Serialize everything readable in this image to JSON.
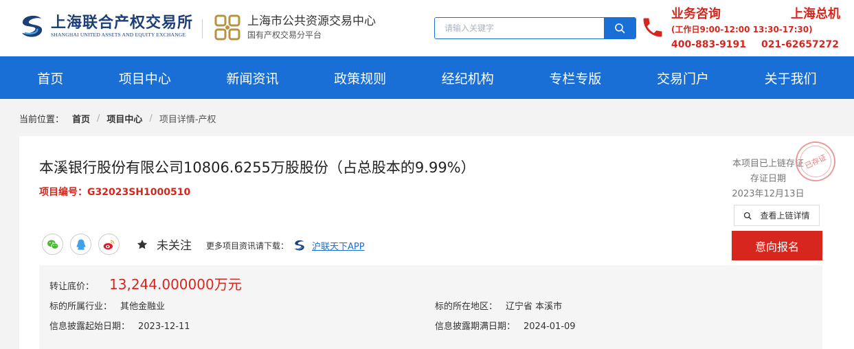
{
  "header": {
    "logo1": {
      "name_cn": "上海联合产权交易所",
      "name_en": "SHANGHAI UNITED ASSETS AND EQUITY EXCHANGE"
    },
    "logo2": {
      "name_cn": "上海市公共资源交易中心",
      "subtitle": "国有产权交易分平台"
    },
    "search": {
      "placeholder": "请输入关键字",
      "value": ""
    },
    "contact": {
      "title1": "业务咨询",
      "title2": "上海总机",
      "hours": "(工作日9:00-12:00 13:30-17:30)",
      "phone1": "400-883-9191",
      "phone2": "021-62657272"
    }
  },
  "nav": {
    "items": [
      "首页",
      "项目中心",
      "新闻资讯",
      "政策规则",
      "经纪机构",
      "专栏专版",
      "交易门户",
      "关于我们"
    ]
  },
  "breadcrumb": {
    "label": "当前位置：",
    "items": [
      "首页",
      "项目中心"
    ],
    "separator": "/",
    "current": "项目详情-产权"
  },
  "project": {
    "title": "本溪银行股份有限公司10806.6255万股股份（占总股本的9.99%）",
    "code_label": "项目编号：",
    "code": "G32023SH1000510",
    "chain_line1": "本项目已上链存证",
    "chain_line2": "存证日期",
    "chain_date": "2023年12月13日",
    "stamp_text": "已存证",
    "view_chain_label": "查看上链详情",
    "apply_label": "意向报名",
    "follow_label": "未关注",
    "download_text": "更多项目资讯请下载：",
    "app_link": "沪联天下APP"
  },
  "info": {
    "price_label": "转让底价：",
    "price_value": "13,244.000000万元",
    "industry_label": "标的所属行业：",
    "industry_value": "其他金融业",
    "region_label": "标的所在地区：",
    "region_value": "辽宁省 本溪市",
    "start_label": "信息披露起始日期：",
    "start_value": "2023-12-11",
    "end_label": "信息披露期满日期：",
    "end_value": "2024-01-09"
  },
  "colors": {
    "brand_blue": "#1a6fd6",
    "accent_red": "#d7261e",
    "logo_navy": "#1c3f7a",
    "logo_gold": "#b8923f"
  },
  "icons": [
    "logo-s-icon",
    "logo-grid-icon",
    "search-icon",
    "phone-icon",
    "wechat-icon",
    "qq-icon",
    "weibo-icon",
    "star-icon",
    "app-logo-icon"
  ]
}
